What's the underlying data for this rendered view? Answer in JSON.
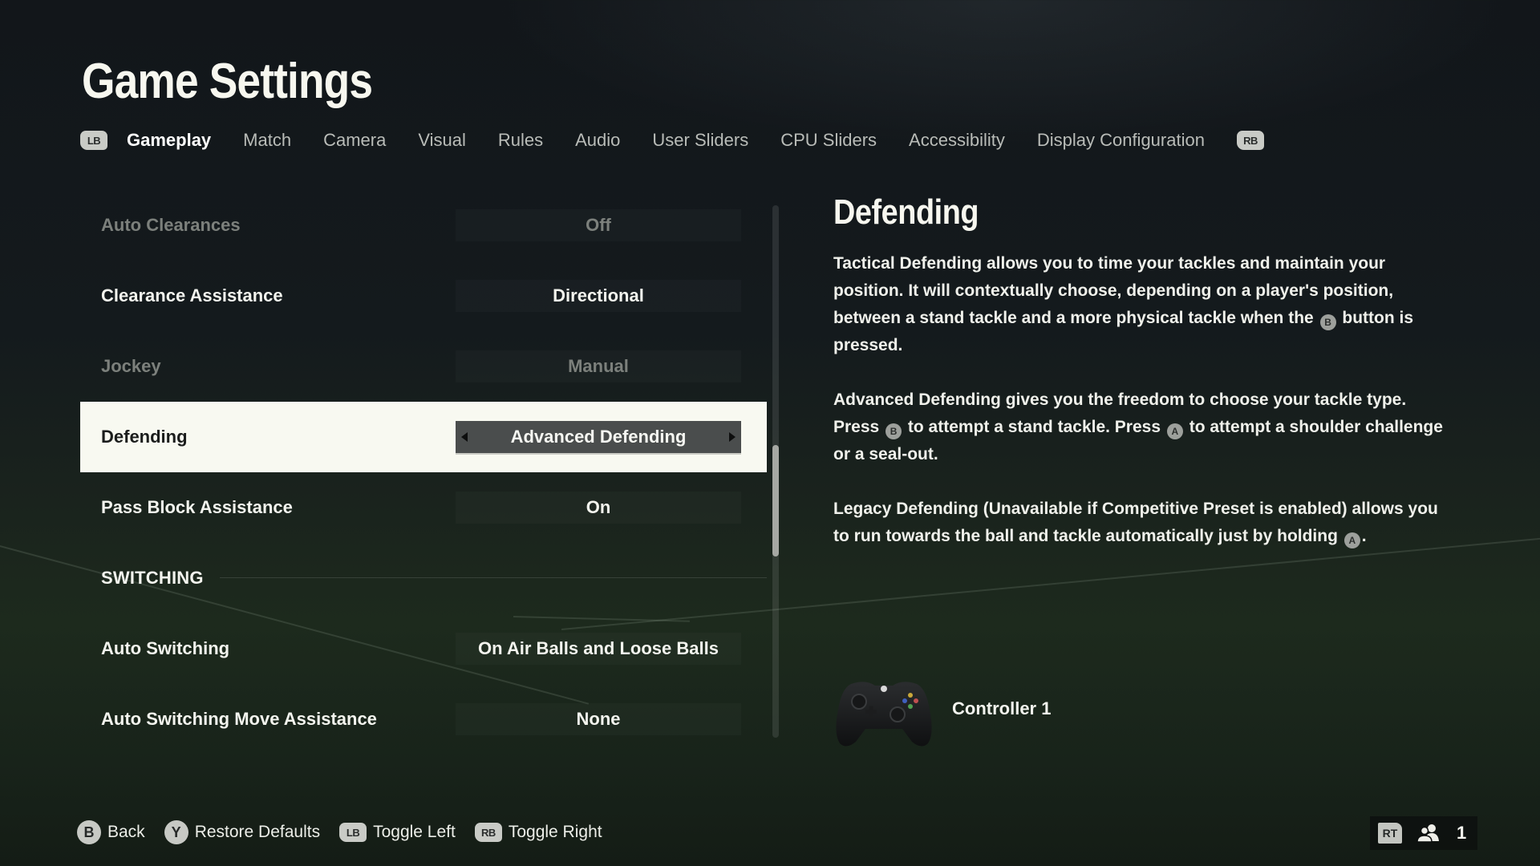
{
  "header": {
    "title": "Game Settings"
  },
  "tabs": {
    "left_bumper": "LB",
    "right_bumper": "RB",
    "items": [
      {
        "label": "Gameplay",
        "active": true
      },
      {
        "label": "Match",
        "active": false
      },
      {
        "label": "Camera",
        "active": false
      },
      {
        "label": "Visual",
        "active": false
      },
      {
        "label": "Rules",
        "active": false
      },
      {
        "label": "Audio",
        "active": false
      },
      {
        "label": "User Sliders",
        "active": false
      },
      {
        "label": "CPU Sliders",
        "active": false
      },
      {
        "label": "Accessibility",
        "active": false
      },
      {
        "label": "Display Configuration",
        "active": false
      }
    ]
  },
  "settings": {
    "rows": [
      {
        "label": "Auto Clearances",
        "value": "Off",
        "state": "disabled"
      },
      {
        "label": "Clearance Assistance",
        "value": "Directional",
        "state": "normal"
      },
      {
        "label": "Jockey",
        "value": "Manual",
        "state": "disabled"
      },
      {
        "label": "Defending",
        "value": "Advanced Defending",
        "state": "selected"
      },
      {
        "label": "Pass Block Assistance",
        "value": "On",
        "state": "normal"
      }
    ],
    "section": {
      "label": "SWITCHING"
    },
    "rows2": [
      {
        "label": "Auto Switching",
        "value": "On Air Balls and Loose Balls",
        "state": "normal"
      },
      {
        "label": "Auto Switching Move Assistance",
        "value": "None",
        "state": "normal"
      }
    ],
    "scroll": {
      "thumb_start_fraction": 0.45,
      "thumb_size_fraction": 0.21
    }
  },
  "detail": {
    "title": "Defending",
    "p1_a": "Tactical Defending allows you to time your tackles and maintain your position. It will contextually choose, depending on a player's position, between a stand tackle and a more physical tackle when the",
    "p1_b": "button is pressed.",
    "p2_a": "Advanced Defending gives you the freedom to choose your tackle type. Press",
    "p2_b": "to attempt a stand tackle. Press",
    "p2_c": "to attempt a shoulder challenge or a seal-out.",
    "p3_a": "Legacy Defending (Unavailable if Competitive Preset is enabled) allows you to run towards the ball and tackle automatically just by holding",
    "p3_b": ".",
    "glyph_b": "B",
    "glyph_a": "A"
  },
  "controller": {
    "label": "Controller 1",
    "icon": "gamepad-icon"
  },
  "footer": {
    "hints": [
      {
        "glyph": "B",
        "label": "Back"
      },
      {
        "glyph": "Y",
        "label": "Restore Defaults"
      },
      {
        "glyph": "LB",
        "label": "Toggle Left"
      },
      {
        "glyph": "RB",
        "label": "Toggle Right"
      }
    ]
  },
  "players": {
    "trigger": "RT",
    "count": "1",
    "icon": "players-icon"
  }
}
